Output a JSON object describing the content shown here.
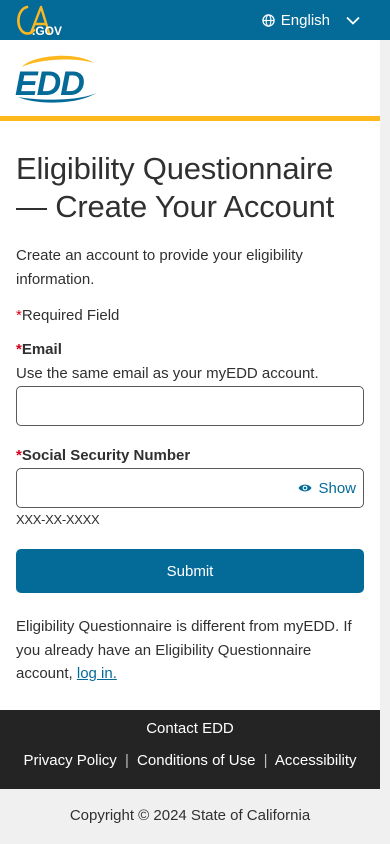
{
  "topbar": {
    "logo_text": "CA.GOV",
    "language": "English"
  },
  "header": {
    "logo_text": "EDD"
  },
  "colors": {
    "primary": "#046b99",
    "gold": "#fdb81e",
    "required": "#d4001c",
    "footer_bg": "#242424"
  },
  "form": {
    "title": "Eligibility Questionnaire — Create Your Account",
    "intro": "Create an account to provide your eligibility information.",
    "required_star": "*",
    "required_note": "Required Field",
    "email_label": "Email",
    "email_hint": "Use the same email as your myEDD account.",
    "email_value": "",
    "ssn_label": "Social Security Number",
    "ssn_value": "",
    "show_label": "Show",
    "ssn_format": "XXX-XX-XXXX",
    "submit_label": "Submit",
    "note_text": "Eligibility Questionnaire is different from myEDD. If you already have an Eligibility Questionnaire account, ",
    "login_link": "log in."
  },
  "footer": {
    "contact": "Contact EDD",
    "links": [
      "Privacy Policy",
      "Conditions of Use",
      "Accessibility"
    ],
    "separator": "|",
    "copyright": "Copyright © 2024 State of California"
  }
}
